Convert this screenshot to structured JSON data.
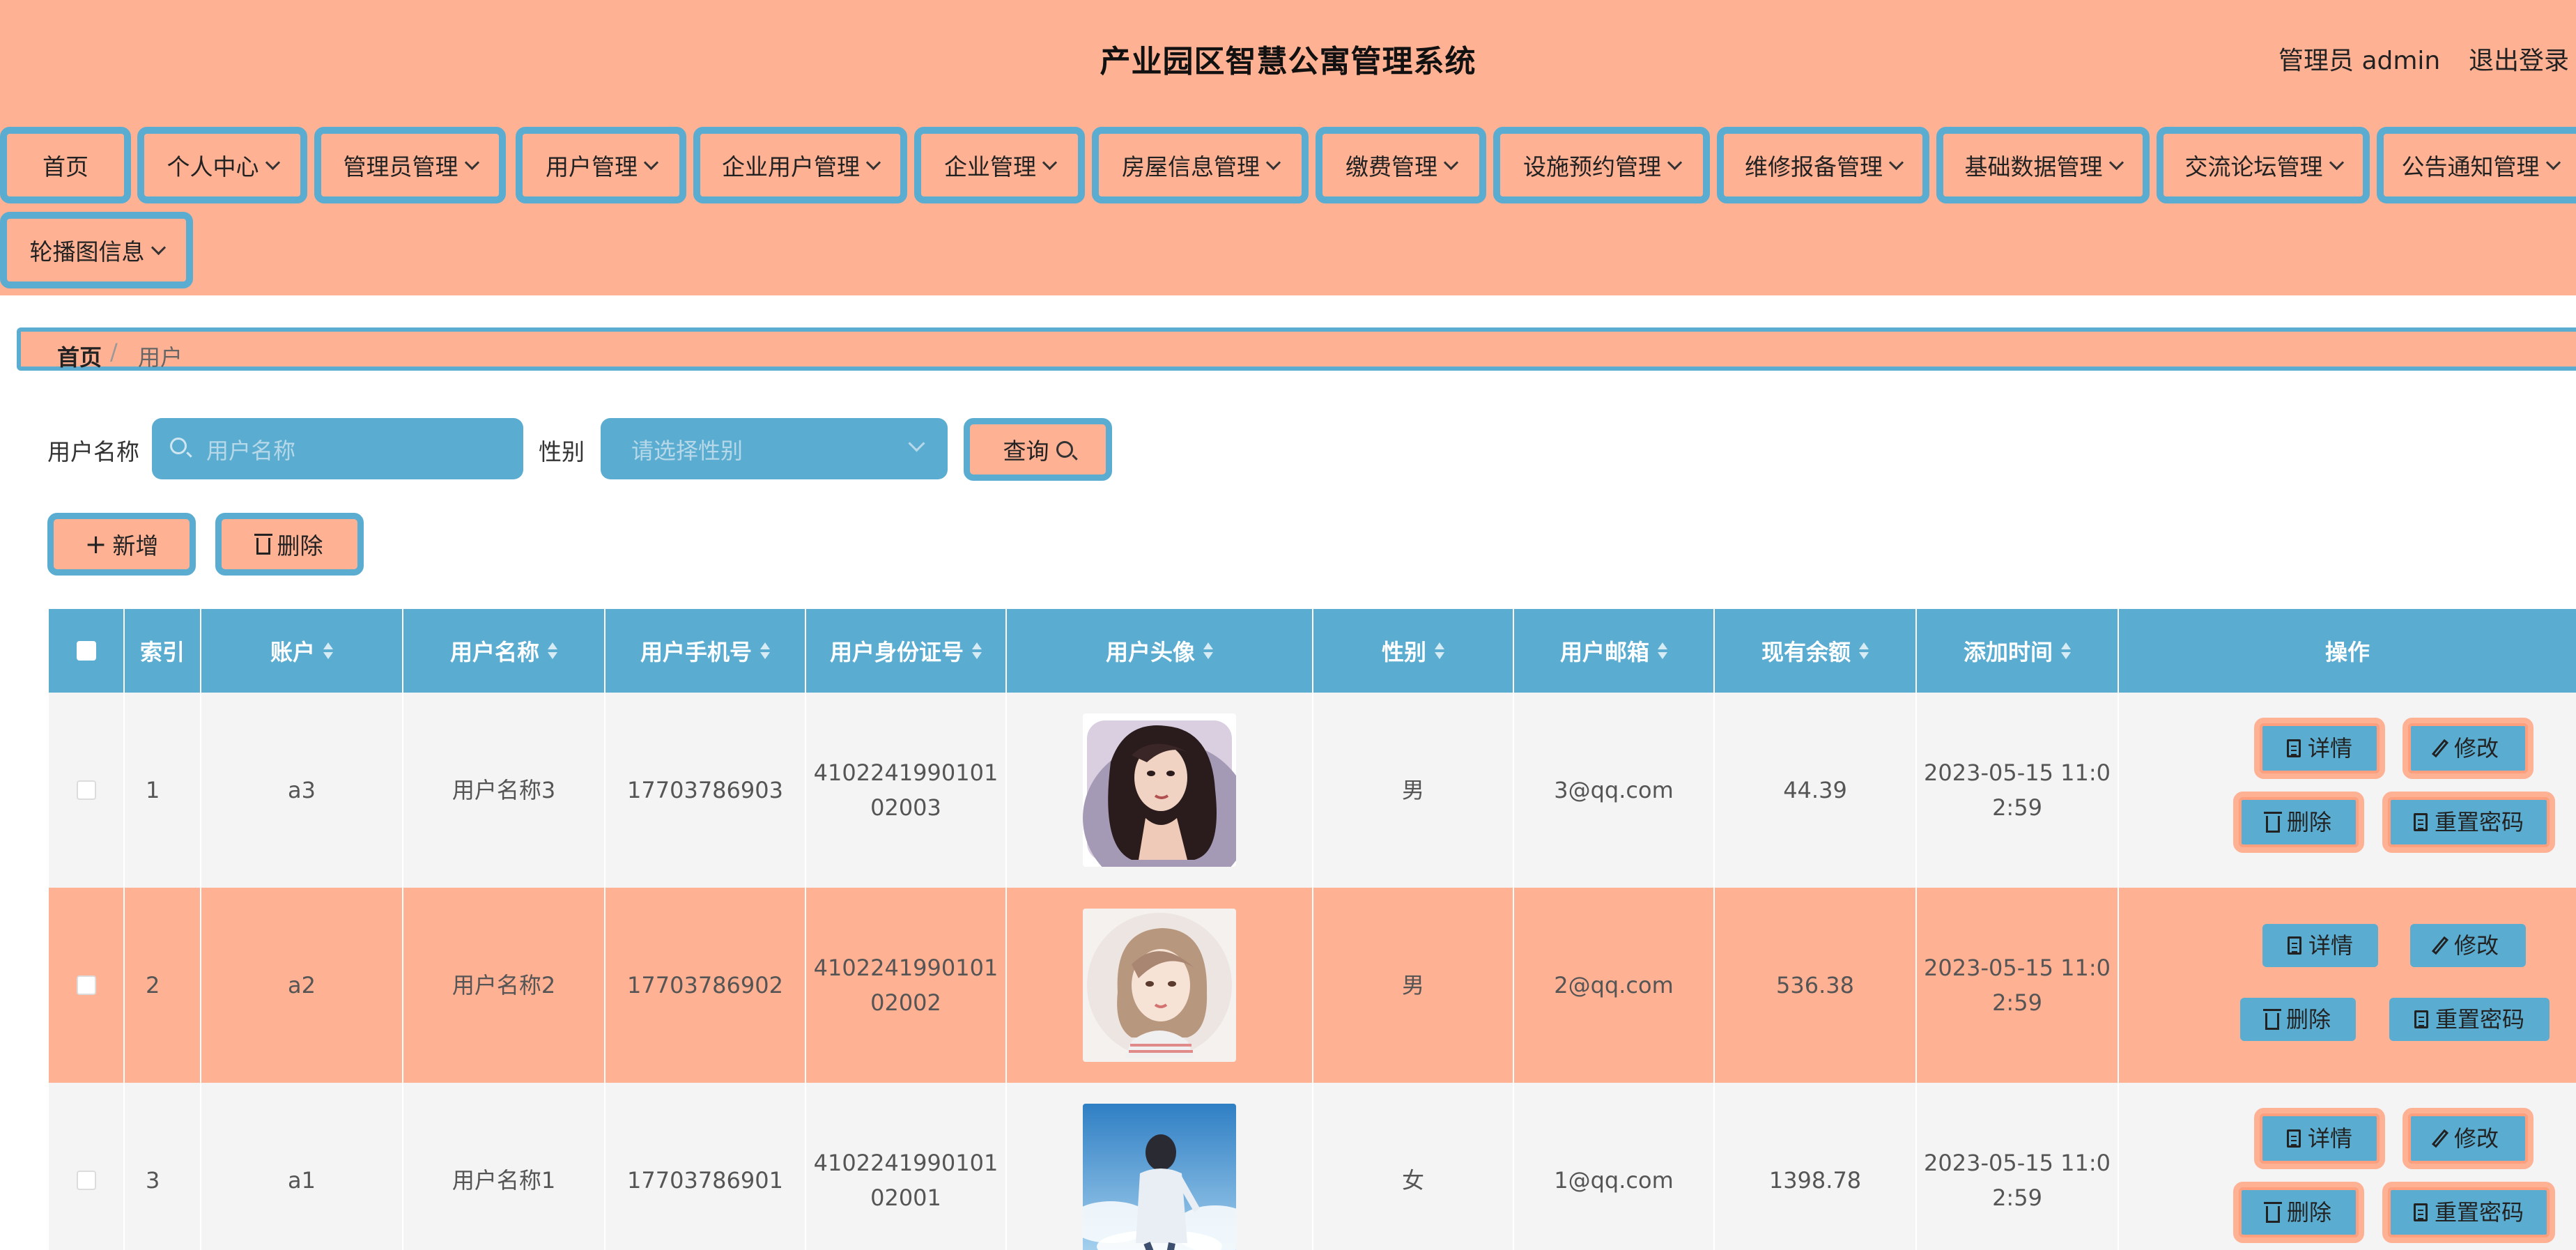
{
  "header": {
    "title": "产业园区智慧公寓管理系统",
    "user": "管理员 admin",
    "logout": "退出登录"
  },
  "menu": {
    "items": [
      {
        "label": "首页"
      },
      {
        "label": "个人中心"
      },
      {
        "label": "管理员管理"
      },
      {
        "label": "用户管理"
      },
      {
        "label": "企业用户管理"
      },
      {
        "label": "企业管理"
      },
      {
        "label": "房屋信息管理"
      },
      {
        "label": "缴费管理"
      },
      {
        "label": "设施预约管理"
      },
      {
        "label": "维修报备管理"
      },
      {
        "label": "基础数据管理"
      },
      {
        "label": "交流论坛管理"
      },
      {
        "label": "公告通知管理"
      },
      {
        "label": "轮播图信息"
      }
    ]
  },
  "breadcrumb": {
    "home": "首页",
    "separator": "/",
    "current": "用户"
  },
  "search": {
    "name_label": "用户名称",
    "name_placeholder": "用户名称",
    "gender_label": "性别",
    "gender_placeholder": "请选择性别",
    "query_label": "查询"
  },
  "actions": {
    "add_label": "新增",
    "delete_label": "删除"
  },
  "table": {
    "columns": [
      "索引",
      "账户",
      "用户名称",
      "用户手机号",
      "用户身份证号",
      "用户头像",
      "性别",
      "用户邮箱",
      "现有余额",
      "添加时间",
      "操作"
    ],
    "rows": [
      {
        "index": "1",
        "account": "a3",
        "name": "用户名称3",
        "phone": "17703786903",
        "id_line1": "4102241990101",
        "id_line2": "02003",
        "gender": "男",
        "email": "3@qq.com",
        "balance": "44.39",
        "time_line1": "2023-05-15 11:0",
        "time_line2": "2:59",
        "avatar": "woman-portrait-on-pillow"
      },
      {
        "index": "2",
        "account": "a2",
        "name": "用户名称2",
        "phone": "17703786902",
        "id_line1": "4102241990101",
        "id_line2": "02002",
        "gender": "男",
        "email": "2@qq.com",
        "balance": "536.38",
        "time_line1": "2023-05-15 11:0",
        "time_line2": "2:59",
        "avatar": "illustrated-girl-circle"
      },
      {
        "index": "3",
        "account": "a1",
        "name": "用户名称1",
        "phone": "17703786901",
        "id_line1": "4102241990101",
        "id_line2": "02001",
        "gender": "女",
        "email": "1@qq.com",
        "balance": "1398.78",
        "time_line1": "2023-05-15 11:0",
        "time_line2": "2:59",
        "avatar": "boy-under-blue-sky"
      }
    ],
    "ops": {
      "detail": "详情",
      "edit": "修改",
      "delete": "删除",
      "reset": "重置密码"
    }
  },
  "colors": {
    "peach": "#ffb194",
    "blue": "#5aadd1",
    "row_gray": "#f4f4f4"
  }
}
